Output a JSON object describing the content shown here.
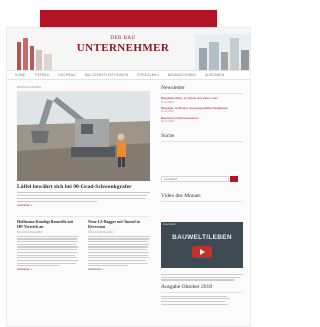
{
  "header": {
    "logo_small": "DER BAU",
    "logo_main": "UNTERNEHMER"
  },
  "nav": [
    "HOME",
    "TIEFBAU",
    "HOCHBAU",
    "BAU-DIENSTLEISTUNGEN",
    "SPEZIALBAU",
    "BAUMASCHINEN",
    "AUSGABEN"
  ],
  "breadcrumb": "BAUMASCHINEN",
  "hero": {
    "title": "Löffel bewährt sich bei 90-Grad-Schwenkgrafer",
    "more": "weiterlesen »"
  },
  "articles": [
    {
      "title": "Hoffmann Kündigt Baustelle mit HP-Vertrieb an",
      "meta": "BAUUNTERNEHMER",
      "more": "weiterlesen »"
    },
    {
      "title": "Neue LS-Bagger mit Tunnel in Reversion",
      "meta": "BAUUNTERNEHMER",
      "more": "weiterlesen »"
    }
  ],
  "sidebar": {
    "newsletter_title": "Newsletter",
    "newsletter_items": [
      {
        "title": "Baustellenticker: im Fokus und vieles mehr",
        "date": "16.10.2018"
      },
      {
        "title": "Baustelle: Hoffmann und ausgewählte Neuigkeiten",
        "date": "16.10.2018"
      },
      {
        "title": "Bauwelt und Wissenswertes",
        "date": "09.10.2018"
      }
    ],
    "search_title": "Suche",
    "search_placeholder": "Suchbegriff",
    "video_title": "Video des Monats",
    "video_label": "Eventvideo",
    "video_big": "BAUWELT/LEBEN",
    "issue_title": "Ausgabe Oktober 2018"
  },
  "colors": {
    "accent": "#b11424",
    "video_bg": "#3e4a52"
  }
}
